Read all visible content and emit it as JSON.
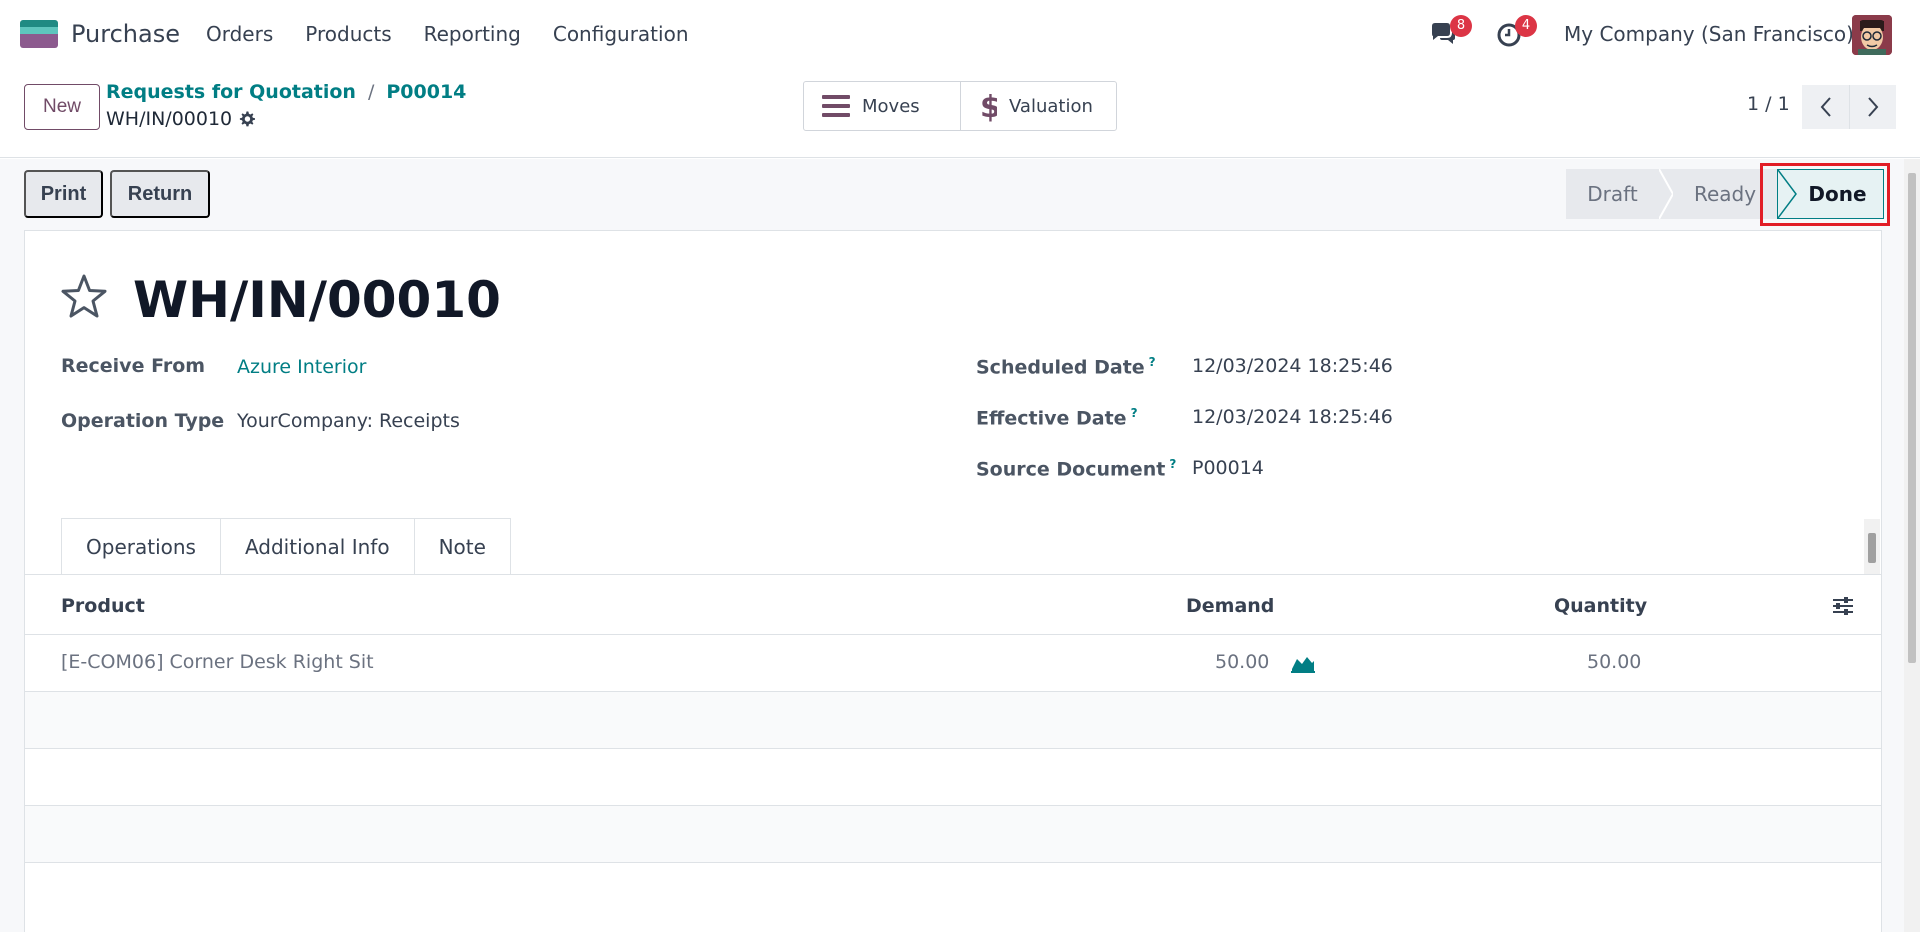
{
  "navbar": {
    "app_name": "Purchase",
    "menu": [
      "Orders",
      "Products",
      "Reporting",
      "Configuration"
    ],
    "chat_badge": "8",
    "activity_badge": "4",
    "company": "My Company (San Francisco)"
  },
  "control": {
    "new_label": "New",
    "breadcrumb": [
      "Requests for Quotation",
      "P00014"
    ],
    "record_name": "WH/IN/00010",
    "smart_buttons": [
      "Moves",
      "Valuation"
    ],
    "pager": "1 / 1"
  },
  "actions": {
    "print": "Print",
    "return": "Return"
  },
  "stages": {
    "draft": "Draft",
    "ready": "Ready",
    "done": "Done"
  },
  "form": {
    "title": "WH/IN/00010",
    "receive_from_label": "Receive From",
    "receive_from": "Azure Interior",
    "operation_type_label": "Operation Type",
    "operation_type": "YourCompany: Receipts",
    "scheduled_date_label": "Scheduled Date",
    "scheduled_date": "12/03/2024 18:25:46",
    "effective_date_label": "Effective Date",
    "effective_date": "12/03/2024 18:25:46",
    "source_document_label": "Source Document",
    "source_document": "P00014",
    "help_mark": "?"
  },
  "tabs": [
    "Operations",
    "Additional Info",
    "Note"
  ],
  "table": {
    "headers": [
      "Product",
      "Demand",
      "Quantity"
    ],
    "rows": [
      {
        "product": "[E-COM06] Corner Desk Right Sit",
        "demand": "50.00",
        "quantity": "50.00"
      }
    ]
  },
  "colors": {
    "brand": "#714b67",
    "link": "#017e84",
    "highlight": "#e11d26"
  }
}
